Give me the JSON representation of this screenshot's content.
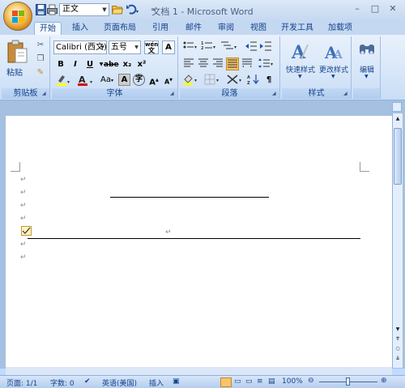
{
  "window": {
    "title": "文档 1 - Microsoft Word"
  },
  "quick_access": {
    "style_value": "正文",
    "icons": [
      "office-logo",
      "save-icon",
      "print-icon",
      "open-icon",
      "undo-icon",
      "customize-icon"
    ]
  },
  "tabs": [
    {
      "label": "开始",
      "active": true
    },
    {
      "label": "插入"
    },
    {
      "label": "页面布局"
    },
    {
      "label": "引用"
    },
    {
      "label": "邮件"
    },
    {
      "label": "审阅"
    },
    {
      "label": "视图"
    },
    {
      "label": "开发工具"
    },
    {
      "label": "加载项"
    }
  ],
  "ribbon": {
    "clipboard": {
      "label": "剪贴板",
      "paste_label": "粘贴"
    },
    "font": {
      "label": "字体",
      "font_name": "Calibri (西文)",
      "font_size": "五号",
      "phonetic_label": "wén",
      "bold": "B",
      "italic": "I",
      "underline": "U",
      "strike": "abe",
      "subscript": "x₂",
      "superscript": "x²",
      "change_case": "Aa",
      "char_border": "A",
      "grow_font": "A",
      "shrink_font": "A"
    },
    "paragraph": {
      "label": "段落"
    },
    "styles": {
      "label": "样式",
      "quick_styles": "快速样式",
      "change_styles": "更改样式"
    },
    "editing": {
      "label": "编辑"
    }
  },
  "status": {
    "page": "页面: 1/1",
    "words": "字数: 0",
    "language": "英语(美国)",
    "insert_mode": "插入",
    "zoom": "100%"
  },
  "colors": {
    "accent": "#15428b",
    "ribbon_bg": "#d7e6f8",
    "frame": "#bfdbff"
  }
}
